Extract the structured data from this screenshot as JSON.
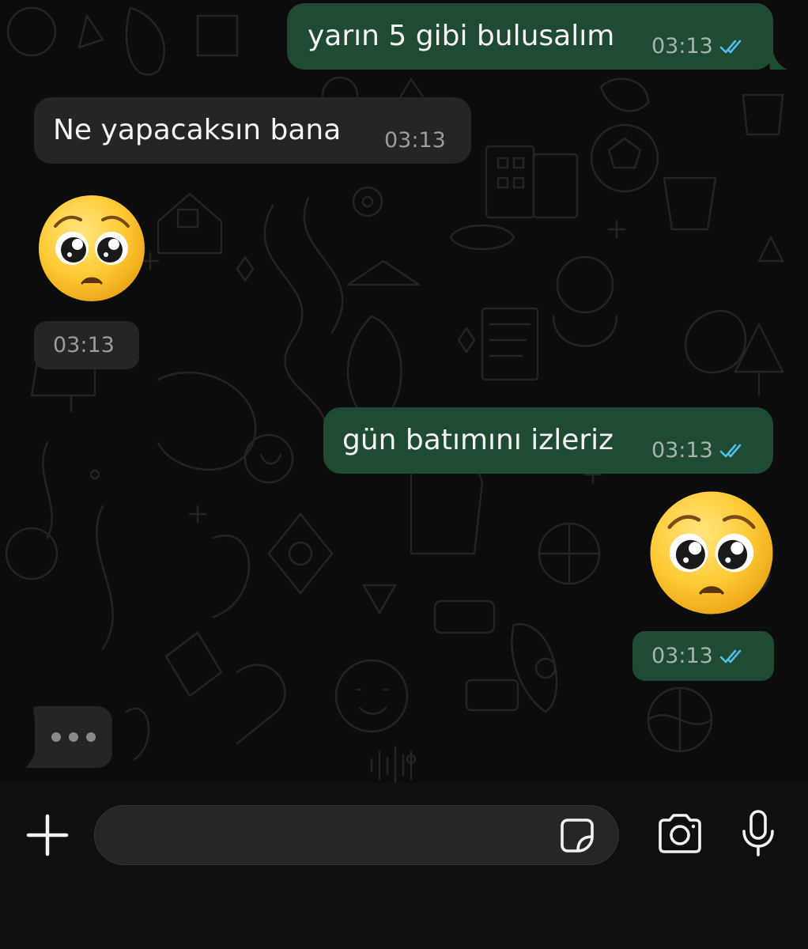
{
  "chat": {
    "messages": [
      {
        "direction": "outgoing",
        "type": "text",
        "text": "yarın 5 gibi bulusalım",
        "time": "03:13",
        "status": "read-double-tick"
      },
      {
        "direction": "incoming",
        "type": "text",
        "text": "Ne yapacaksın bana",
        "time": "03:13"
      },
      {
        "direction": "incoming",
        "type": "emoji",
        "emoji": "pleading-face",
        "time": "03:13"
      },
      {
        "direction": "outgoing",
        "type": "text",
        "text": "gün batımını izleriz",
        "time": "03:13",
        "status": "read-double-tick"
      },
      {
        "direction": "outgoing",
        "type": "emoji",
        "emoji": "pleading-face",
        "time": "03:13",
        "status": "read-double-tick"
      }
    ],
    "typing_indicator": "•••"
  },
  "composer": {
    "input_value": "",
    "icons": [
      "plus-icon",
      "sticker-icon",
      "camera-icon",
      "microphone-icon"
    ]
  },
  "colors": {
    "outgoing_bubble": "#1f4a33",
    "incoming_bubble": "#242626",
    "read_tick": "#53bdeb",
    "background": "#0b0c0b"
  }
}
